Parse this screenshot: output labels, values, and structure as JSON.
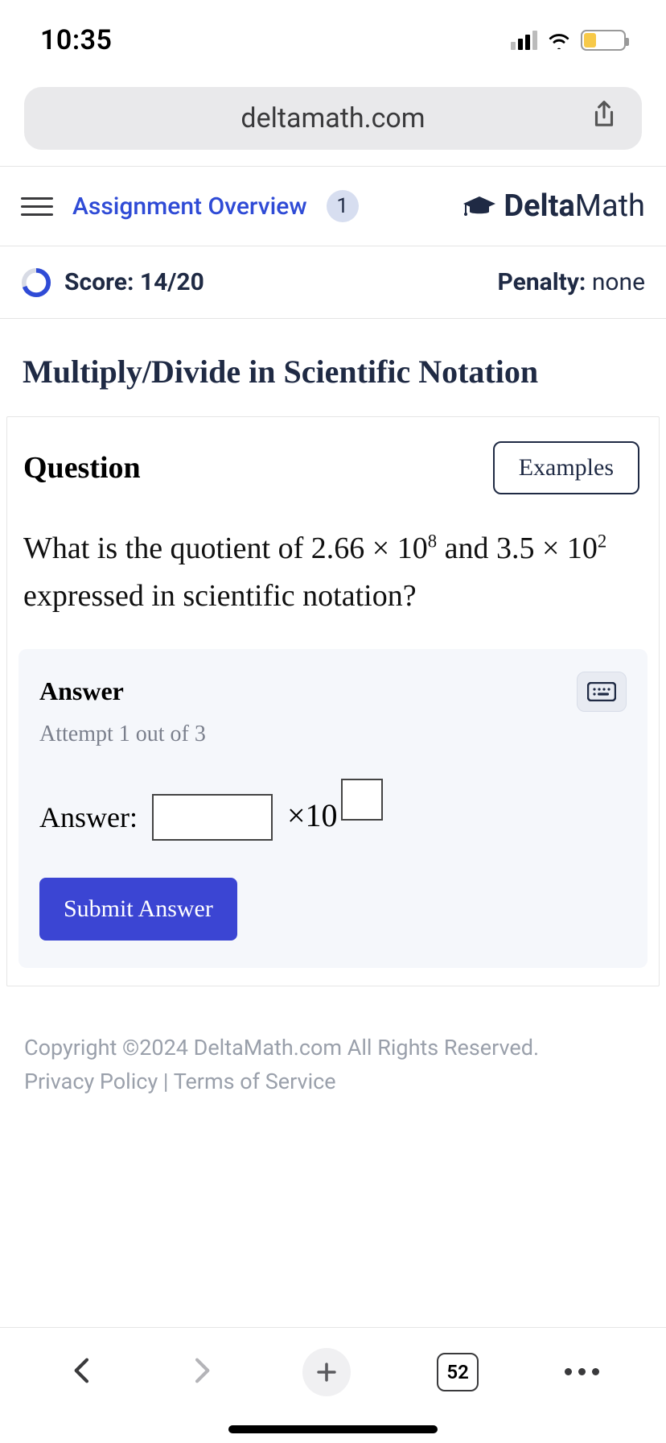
{
  "status": {
    "time": "10:35"
  },
  "url_bar": {
    "domain": "deltamath.com"
  },
  "header": {
    "assignment_link": "Assignment Overview",
    "badge_count": "1",
    "brand_a": "Delta",
    "brand_b": "Math"
  },
  "score_row": {
    "score_label": "Score: 14/20",
    "penalty_label": "Penalty: ",
    "penalty_value": "none"
  },
  "title": "Multiply/Divide in Scientific Notation",
  "card": {
    "heading": "Question",
    "examples_btn": "Examples",
    "question_pre": "What is the quotient of ",
    "val1_coef": "2.66",
    "times": " × ",
    "ten": "10",
    "val1_exp": "8",
    "and_word": " and ",
    "val2_coef": "3.5",
    "val2_exp": "2",
    "question_post": " expressed in scientific notation?"
  },
  "answer": {
    "heading": "Answer",
    "attempt": "Attempt 1 out of 3",
    "label": "Answer:",
    "times10": "×10",
    "submit": "Submit Answer"
  },
  "footer": {
    "copyright": "Copyright ©2024 DeltaMath.com All Rights Reserved.",
    "privacy": "Privacy Policy",
    "sep": " | ",
    "terms": "Terms of Service"
  },
  "browser": {
    "tab_count": "52"
  }
}
